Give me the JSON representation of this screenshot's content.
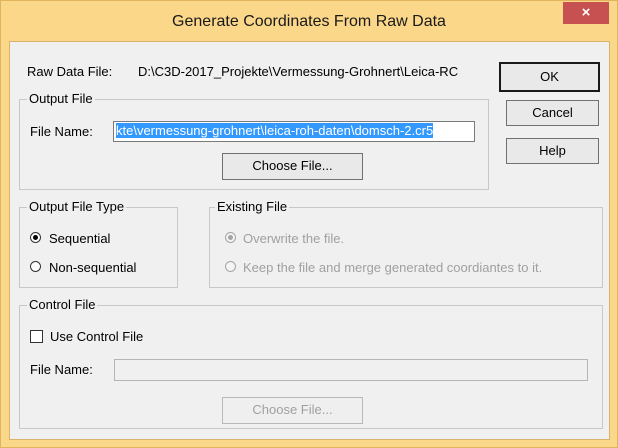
{
  "window": {
    "title": "Generate Coordinates From Raw Data",
    "close_glyph": "×"
  },
  "raw_data": {
    "label": "Raw Data File:",
    "value": "D:\\C3D-2017_Projekte\\Vermessung-Grohnert\\Leica-RC"
  },
  "buttons": {
    "ok": "OK",
    "cancel": "Cancel",
    "help": "Help"
  },
  "output_file": {
    "group_title": "Output File",
    "file_name_label": "File Name:",
    "file_name_value": "kte\\vermessung-grohnert\\leica-roh-daten\\domsch-2.cr5",
    "choose_label": "Choose File..."
  },
  "output_file_type": {
    "group_title": "Output File Type",
    "options": [
      {
        "label": "Sequential",
        "checked": true
      },
      {
        "label": "Non-sequential",
        "checked": false
      }
    ]
  },
  "existing_file": {
    "group_title": "Existing File",
    "options": [
      {
        "label": "Overwrite the file.",
        "checked": true,
        "enabled": false
      },
      {
        "label": "Keep the file and merge generated coordiantes to it.",
        "checked": false,
        "enabled": false
      }
    ]
  },
  "control_file": {
    "group_title": "Control File",
    "use_label": "Use Control File",
    "use_checked": false,
    "file_name_label": "File Name:",
    "file_name_value": "",
    "choose_label": "Choose File..."
  },
  "colors": {
    "title_bar": "#fbd78a",
    "close_button": "#c75050",
    "dialog": "#f0f0f0",
    "selection": "#3399ff"
  }
}
